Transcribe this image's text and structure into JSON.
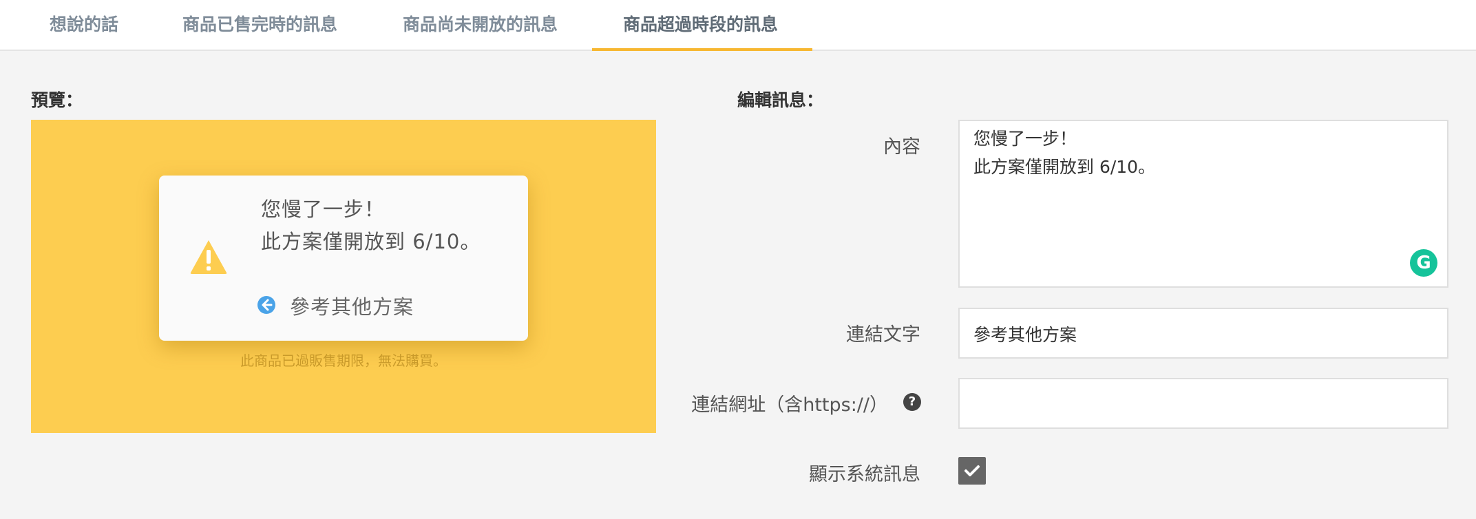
{
  "tabs": [
    {
      "label": "想說的話"
    },
    {
      "label": "商品已售完時的訊息"
    },
    {
      "label": "商品尚未開放的訊息"
    },
    {
      "label": "商品超過時段的訊息",
      "active": true
    }
  ],
  "colors": {
    "accent": "#f7b731",
    "preview_bg": "#fdcd50",
    "grammarly": "#15c39a"
  },
  "preview": {
    "label": "預覽：",
    "dialog": {
      "icon": "warning-icon",
      "line1": "您慢了一步！",
      "line2": "此方案僅開放到 6/10。",
      "link_icon": "arrow-left-circle-icon",
      "link_text": "參考其他方案"
    },
    "system_message": "此商品已過販售期限，無法購買。"
  },
  "editor": {
    "label": "編輯訊息：",
    "content_label": "內容",
    "content_line1": "您慢了一步！",
    "content_line2": "此方案僅開放到 6/10。",
    "grammarly_icon": "grammarly-icon",
    "grammarly_letter": "G",
    "link_text_label": "連結文字",
    "link_text_value": "參考其他方案",
    "link_url_label": "連結網址（含https://）",
    "link_url_value": "",
    "help_icon": "question-circle-icon",
    "help_symbol": "?",
    "show_system_label": "顯示系統訊息",
    "show_system_checked": true
  }
}
